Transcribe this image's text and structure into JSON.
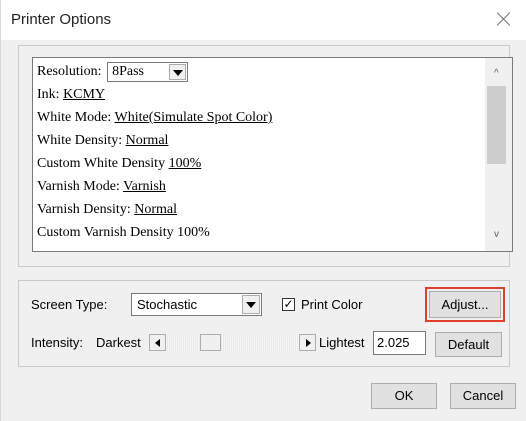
{
  "window": {
    "title": "Printer Options"
  },
  "options_list": {
    "resolution": {
      "label": "Resolution:",
      "value": "8Pass"
    },
    "items": [
      {
        "label": "Ink:",
        "value": "KCMY"
      },
      {
        "label": "White Mode:",
        "value": "White(Simulate Spot Color)"
      },
      {
        "label": "White Density:",
        "value": "Normal"
      },
      {
        "label": "Custom White Density",
        "value": "100%"
      },
      {
        "label": "Varnish Mode:",
        "value": "Varnish"
      },
      {
        "label": "Varnish Density:",
        "value": "Normal"
      },
      {
        "label": "Custom Varnish Density",
        "value": "100%"
      }
    ],
    "scroll_up_glyph": "^",
    "scroll_down_glyph": "v"
  },
  "screen": {
    "type_label": "Screen Type:",
    "type_value": "Stochastic",
    "print_color_label": "Print Color",
    "print_color_checked": "✓",
    "intensity_label": "Intensity:",
    "darkest_label": "Darkest",
    "lightest_label": "Lightest",
    "intensity_value": "2.025",
    "intensity_slider_level": 0.3
  },
  "buttons": {
    "adjust": "Adjust...",
    "default": "Default",
    "ok": "OK",
    "cancel": "Cancel"
  },
  "colors": {
    "highlight": "#e0402b",
    "dialog_bg": "#f0f0f0"
  }
}
